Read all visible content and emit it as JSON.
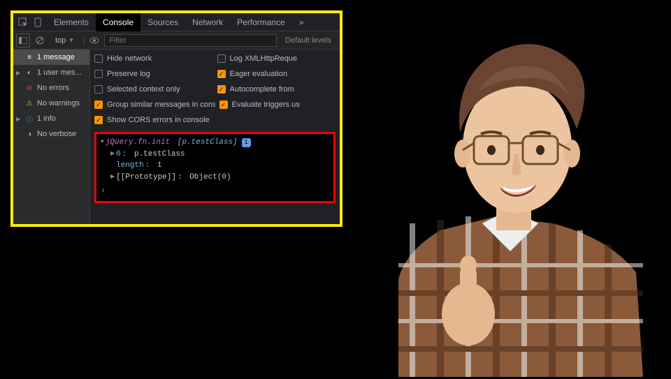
{
  "tabs": {
    "elements": "Elements",
    "console": "Console",
    "sources": "Sources",
    "network": "Network",
    "performance": "Performance",
    "more": "»"
  },
  "toolbar": {
    "context": "top",
    "filter_placeholder": "Filter",
    "levels": "Default levels"
  },
  "sidebar": [
    {
      "icon": "≡",
      "label": "1 message",
      "active": true
    },
    {
      "icon": "◐",
      "label": "1 user mes...",
      "arrow": true
    },
    {
      "icon": "⊘",
      "label": "No errors",
      "color": "#d94a4a"
    },
    {
      "icon": "⚠",
      "label": "No warnings",
      "color": "#e8b33c"
    },
    {
      "icon": "ⓘ",
      "label": "1 info",
      "color": "#5e9de6",
      "arrow": true
    },
    {
      "icon": "◑",
      "label": "No verbose"
    }
  ],
  "settings": {
    "rows": [
      {
        "l": {
          "label": "Hide network",
          "checked": false
        },
        "r": {
          "label": "Log XMLHttpReque",
          "checked": false
        }
      },
      {
        "l": {
          "label": "Preserve log",
          "checked": false
        },
        "r": {
          "label": "Eager evaluation",
          "checked": true
        }
      },
      {
        "l": {
          "label": "Selected context only",
          "checked": false
        },
        "r": {
          "label": "Autocomplete from",
          "checked": true
        }
      },
      {
        "l": {
          "label": "Group similar messages in console",
          "checked": true
        },
        "r": {
          "label": "Evaluate triggers us",
          "checked": true
        }
      },
      {
        "l": {
          "label": "Show CORS errors in console",
          "checked": true
        },
        "r": null
      }
    ]
  },
  "output": {
    "header_type": "jQuery.fn.init",
    "header_bracket": "[p.testClass]",
    "line0_key": "0",
    "line0_val": "p.testClass",
    "length_key": "length",
    "length_val": "1",
    "proto_key": "[[Prototype]]",
    "proto_val": "Object(0)"
  }
}
